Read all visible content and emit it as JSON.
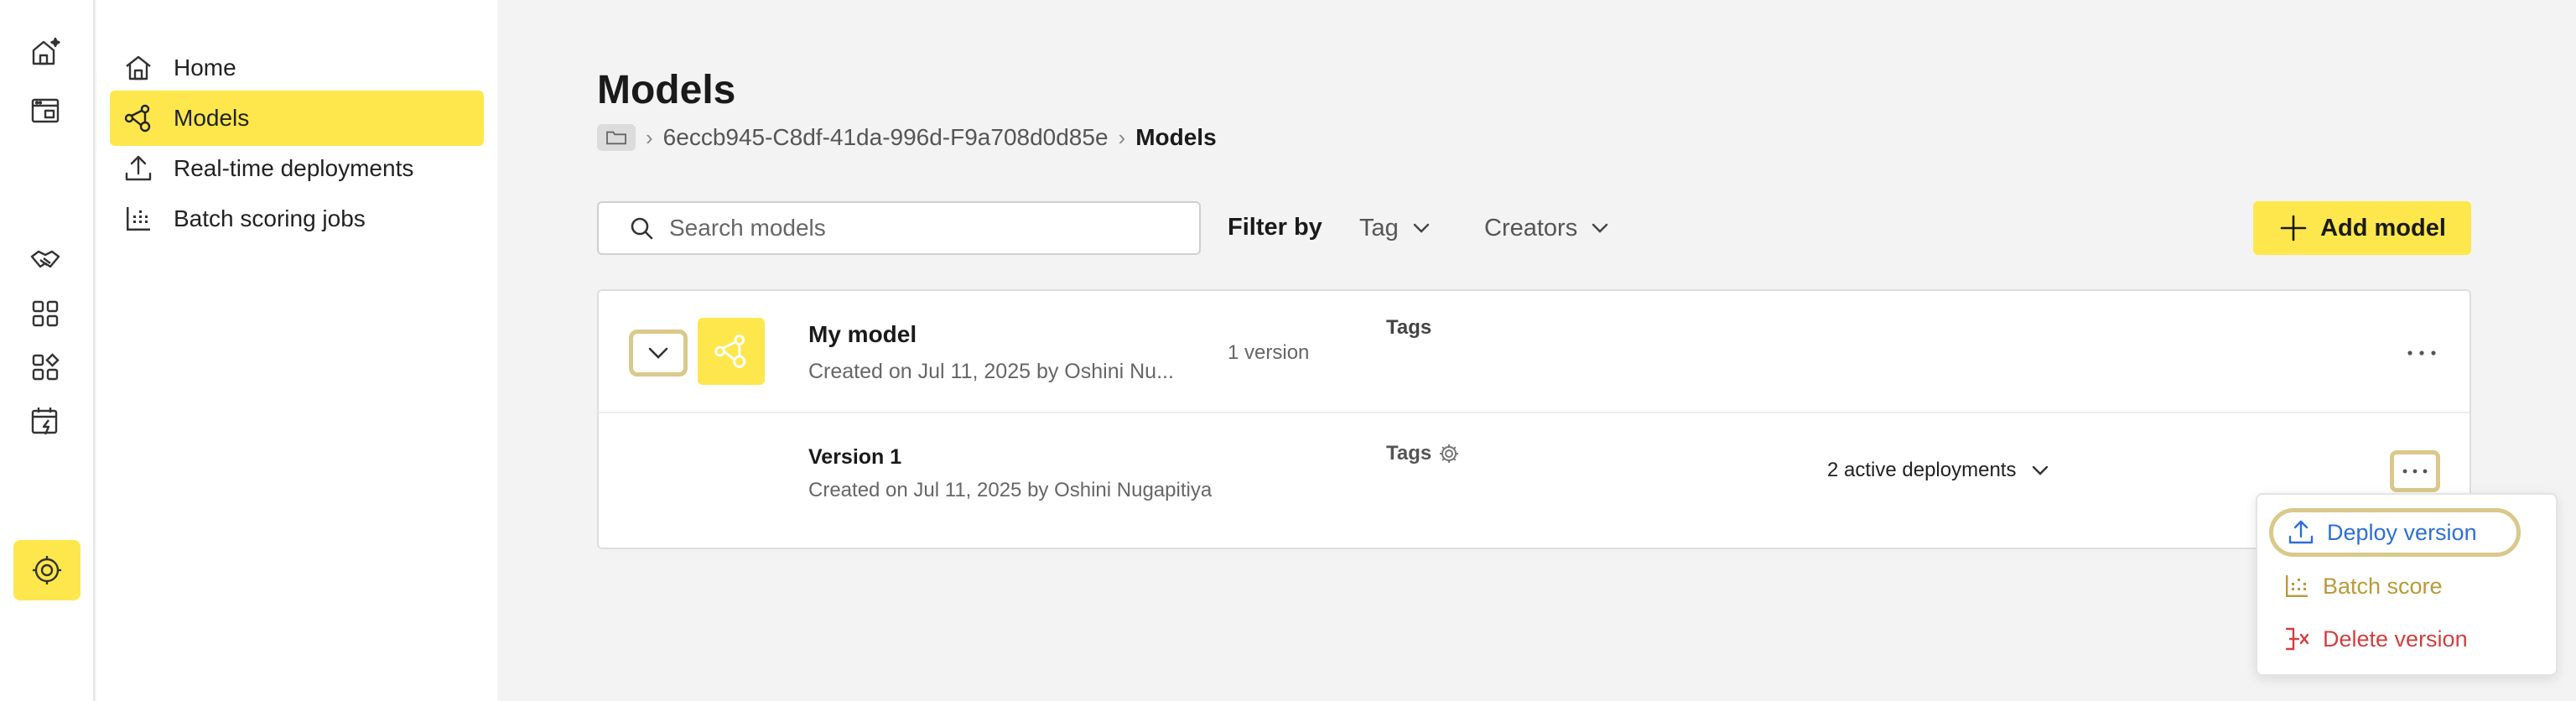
{
  "sidebar": {
    "items": [
      {
        "label": "Home",
        "icon": "home-icon"
      },
      {
        "label": "Models",
        "icon": "models-icon",
        "active": true
      },
      {
        "label": "Real-time deployments",
        "icon": "upload-icon"
      },
      {
        "label": "Batch scoring jobs",
        "icon": "batch-icon"
      }
    ]
  },
  "rail": {
    "icons": [
      "home-ai-icon",
      "store-icon",
      "handshake-icon",
      "apps-grid-icon",
      "apps-add-icon",
      "calendar-bolt-icon",
      "model-settings-icon"
    ]
  },
  "header": {
    "title": "Models",
    "breadcrumb": {
      "project": "6eccb945-C8df-41da-996d-F9a708d0d85e",
      "current": "Models"
    }
  },
  "toolbar": {
    "search_placeholder": "Search models",
    "filter_label": "Filter by",
    "filter_tag": "Tag",
    "filter_creators": "Creators",
    "add_label": "Add model"
  },
  "model": {
    "name": "My model",
    "meta": "Created on Jul 11, 2025 by Oshini Nu...",
    "version_count": "1 version",
    "tags_label": "Tags",
    "versions": [
      {
        "name": "Version 1",
        "meta": "Created on Jul 11, 2025 by Oshini Nugapitiya",
        "tags_label": "Tags",
        "active_deployments": "2 active deployments"
      }
    ]
  },
  "menu": {
    "deploy": "Deploy version",
    "batch": "Batch score",
    "delete": "Delete version"
  },
  "colors": {
    "accent": "#fde74c",
    "highlight_ring": "#d9c98a",
    "deploy": "#2e6fd6",
    "batch": "#b99a38",
    "delete": "#d23f3f"
  }
}
